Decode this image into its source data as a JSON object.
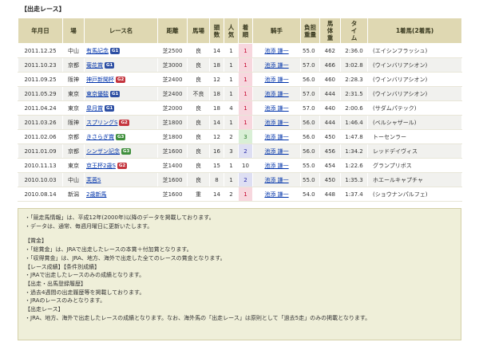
{
  "section_title": "【出走レース】",
  "columns": [
    "年月日",
    "場",
    "レース名",
    "距離",
    "馬場",
    "頭数",
    "人気",
    "着順",
    "騎手",
    "負担重量",
    "馬体重",
    "タイム",
    "1着馬(2着馬)"
  ],
  "rows": [
    {
      "date": "2011.12.25",
      "venue": "中山",
      "race": "有馬記念",
      "grade": "G1",
      "grade_color": "blue",
      "dist": "芝2500",
      "track": "良",
      "field": "14",
      "pop": "1",
      "finish": "1",
      "jockey": "池添 謙一",
      "weight": "55.0",
      "body": "462",
      "time": "2:36.0",
      "winner": "(エイシンフラッシュ)"
    },
    {
      "date": "2011.10.23",
      "venue": "京都",
      "race": "菊花賞",
      "grade": "G1",
      "grade_color": "blue",
      "dist": "芝3000",
      "track": "良",
      "field": "18",
      "pop": "1",
      "finish": "1",
      "jockey": "池添 謙一",
      "weight": "57.0",
      "body": "466",
      "time": "3:02.8",
      "winner": "(ウインバリアシオン)"
    },
    {
      "date": "2011.09.25",
      "venue": "阪神",
      "race": "神戸新聞杯",
      "grade": "G2",
      "grade_color": "red",
      "dist": "芝2400",
      "track": "良",
      "field": "12",
      "pop": "1",
      "finish": "1",
      "jockey": "池添 謙一",
      "weight": "56.0",
      "body": "460",
      "time": "2:28.3",
      "winner": "(ウインバリアシオン)"
    },
    {
      "date": "2011.05.29",
      "venue": "東京",
      "race": "東京優駿",
      "grade": "G1",
      "grade_color": "blue",
      "dist": "芝2400",
      "track": "不良",
      "field": "18",
      "pop": "1",
      "finish": "1",
      "jockey": "池添 謙一",
      "weight": "57.0",
      "body": "444",
      "time": "2:31.5",
      "winner": "(ウインバリアシオン)"
    },
    {
      "date": "2011.04.24",
      "venue": "東京",
      "race": "皐月賞",
      "grade": "G1",
      "grade_color": "blue",
      "dist": "芝2000",
      "track": "良",
      "field": "18",
      "pop": "4",
      "finish": "1",
      "jockey": "池添 謙一",
      "weight": "57.0",
      "body": "440",
      "time": "2:00.6",
      "winner": "(サダムパテック)"
    },
    {
      "date": "2011.03.26",
      "venue": "阪神",
      "race": "スプリングS",
      "grade": "G2",
      "grade_color": "red",
      "dist": "芝1800",
      "track": "良",
      "field": "14",
      "pop": "1",
      "finish": "1",
      "jockey": "池添 謙一",
      "weight": "56.0",
      "body": "444",
      "time": "1:46.4",
      "winner": "(ベルシャザール)"
    },
    {
      "date": "2011.02.06",
      "venue": "京都",
      "race": "きさらぎ賞",
      "grade": "G3",
      "grade_color": "green",
      "dist": "芝1800",
      "track": "良",
      "field": "12",
      "pop": "2",
      "finish": "3",
      "jockey": "池添 謙一",
      "weight": "56.0",
      "body": "450",
      "time": "1:47.8",
      "winner": "トーセンラー"
    },
    {
      "date": "2011.01.09",
      "venue": "京都",
      "race": "シンザン記念",
      "grade": "G3",
      "grade_color": "green",
      "dist": "芝1600",
      "track": "良",
      "field": "16",
      "pop": "3",
      "finish": "2",
      "jockey": "池添 謙一",
      "weight": "56.0",
      "body": "456",
      "time": "1:34.2",
      "winner": "レッドデイヴィス"
    },
    {
      "date": "2010.11.13",
      "venue": "東京",
      "race": "京王杯2歳S",
      "grade": "G2",
      "grade_color": "red",
      "dist": "芝1400",
      "track": "良",
      "field": "15",
      "pop": "1",
      "finish": "10",
      "jockey": "池添 謙一",
      "weight": "55.0",
      "body": "454",
      "time": "1:22.6",
      "winner": "グランプリボス"
    },
    {
      "date": "2010.10.03",
      "venue": "中山",
      "race": "芙蓉S",
      "grade": "",
      "grade_color": "",
      "dist": "芝1600",
      "track": "良",
      "field": "8",
      "pop": "1",
      "finish": "2",
      "jockey": "池添 謙一",
      "weight": "55.0",
      "body": "450",
      "time": "1:35.3",
      "winner": "ホエールキャプチャ"
    },
    {
      "date": "2010.08.14",
      "venue": "新潟",
      "race": "2歳新馬",
      "grade": "",
      "grade_color": "",
      "dist": "芝1600",
      "track": "重",
      "field": "14",
      "pop": "2",
      "finish": "1",
      "jockey": "池添 謙一",
      "weight": "54.0",
      "body": "448",
      "time": "1:37.4",
      "winner": "(ショウナンパルフェ)"
    }
  ],
  "notes": [
    "・「競走馬情報」は、平成12年(2000年)以降のデータを掲載しております。",
    "・データは、通常、毎週月曜日に更新いたします。",
    "",
    "【賞金】",
    "・「総賞金」は、JRAで出走したレースの本賞＋付加賞となります。",
    "・「収得賞金」は、JRA、地方、海外で出走した全てのレースの賞金となります。",
    "【レース成績】【条件別成績】",
    "・JRAで出走したレースのみの成績となります。",
    "【出走・出馬登録履歴】",
    "・過去4週間の出走履歴等を掲載しております。",
    "・JRAのレースのみとなります。",
    "【出走レース】",
    "・JRA、地方、海外で出走したレースの成績となります。なお、海外馬の「出走レース」は原則として「過去5走」のみの掲載となります。"
  ]
}
